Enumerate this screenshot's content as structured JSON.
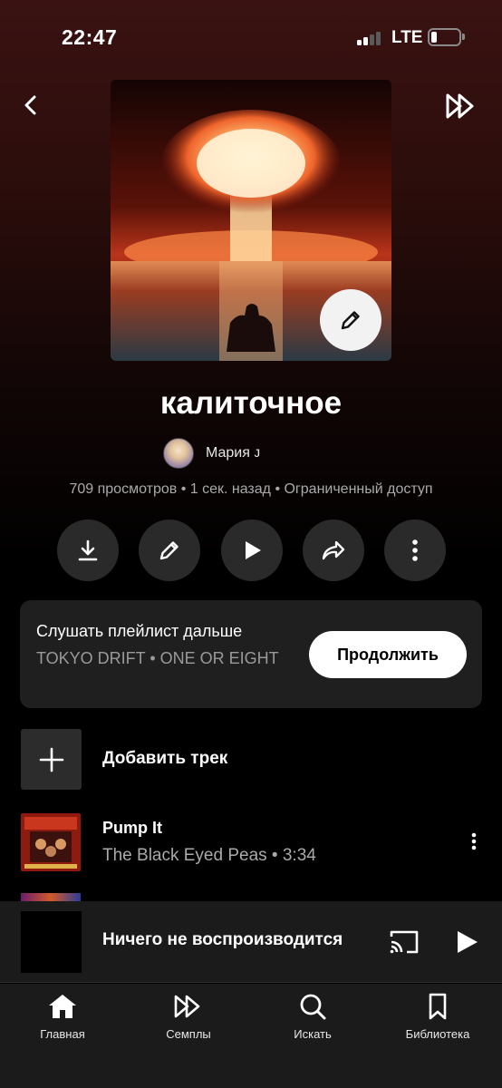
{
  "status_bar": {
    "time": "22:47",
    "network": "LTE",
    "signal_icon": "signal-bars-icon",
    "battery_icon": "battery-icon"
  },
  "header": {
    "back_icon": "chevron-left-icon",
    "shuffle_icon": "shuffle-play-icon"
  },
  "playlist": {
    "title": "калиточное",
    "owner": "Мария ᴊ",
    "meta": "709 просмотров • 1 сек. назад • Ограниченный доступ",
    "cover_edit_icon": "pencil-icon"
  },
  "actions": [
    "download-icon",
    "pencil-icon",
    "play-icon",
    "share-icon",
    "more-vertical-icon"
  ],
  "resume": {
    "title": "Слушать плейлист дальше",
    "track": "TOKYO DRIFT • ONE OR EIGHT",
    "button": "Продолжить"
  },
  "add_track": {
    "label": "Добавить трек",
    "icon": "plus-icon"
  },
  "tracks": [
    {
      "title": "Pump It",
      "subtitle": "The Black Eyed Peas • 3:34",
      "more_icon": "more-vertical-icon"
    }
  ],
  "mini_player": {
    "text": "Ничего не воспроизводится",
    "cast_icon": "cast-icon",
    "play_icon": "play-icon"
  },
  "nav": [
    {
      "label": "Главная",
      "icon": "home-icon"
    },
    {
      "label": "Семплы",
      "icon": "samples-icon"
    },
    {
      "label": "Искать",
      "icon": "search-icon"
    },
    {
      "label": "Библиотека",
      "icon": "bookmark-icon"
    }
  ],
  "colors": {
    "accent": "#ffffff",
    "card": "#1f1f1f",
    "button": "#2a2a2a",
    "muted_text": "#aaaaaa"
  }
}
